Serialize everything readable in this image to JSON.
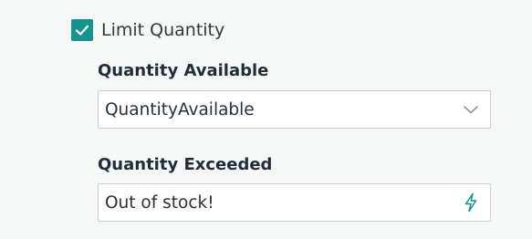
{
  "limit_quantity": {
    "label": "Limit Quantity",
    "checked": true
  },
  "quantity_available": {
    "label": "Quantity Available",
    "value": "QuantityAvailable"
  },
  "quantity_exceeded": {
    "label": "Quantity Exceeded",
    "value": "Out of stock!"
  },
  "colors": {
    "accent": "#17928c",
    "background": "#f6f7f7",
    "field_border": "#c9cfd3",
    "label_text": "#1f2d3a"
  },
  "icons": {
    "checkbox": "check-icon",
    "select": "chevron-down-icon",
    "input": "lightning-icon"
  }
}
